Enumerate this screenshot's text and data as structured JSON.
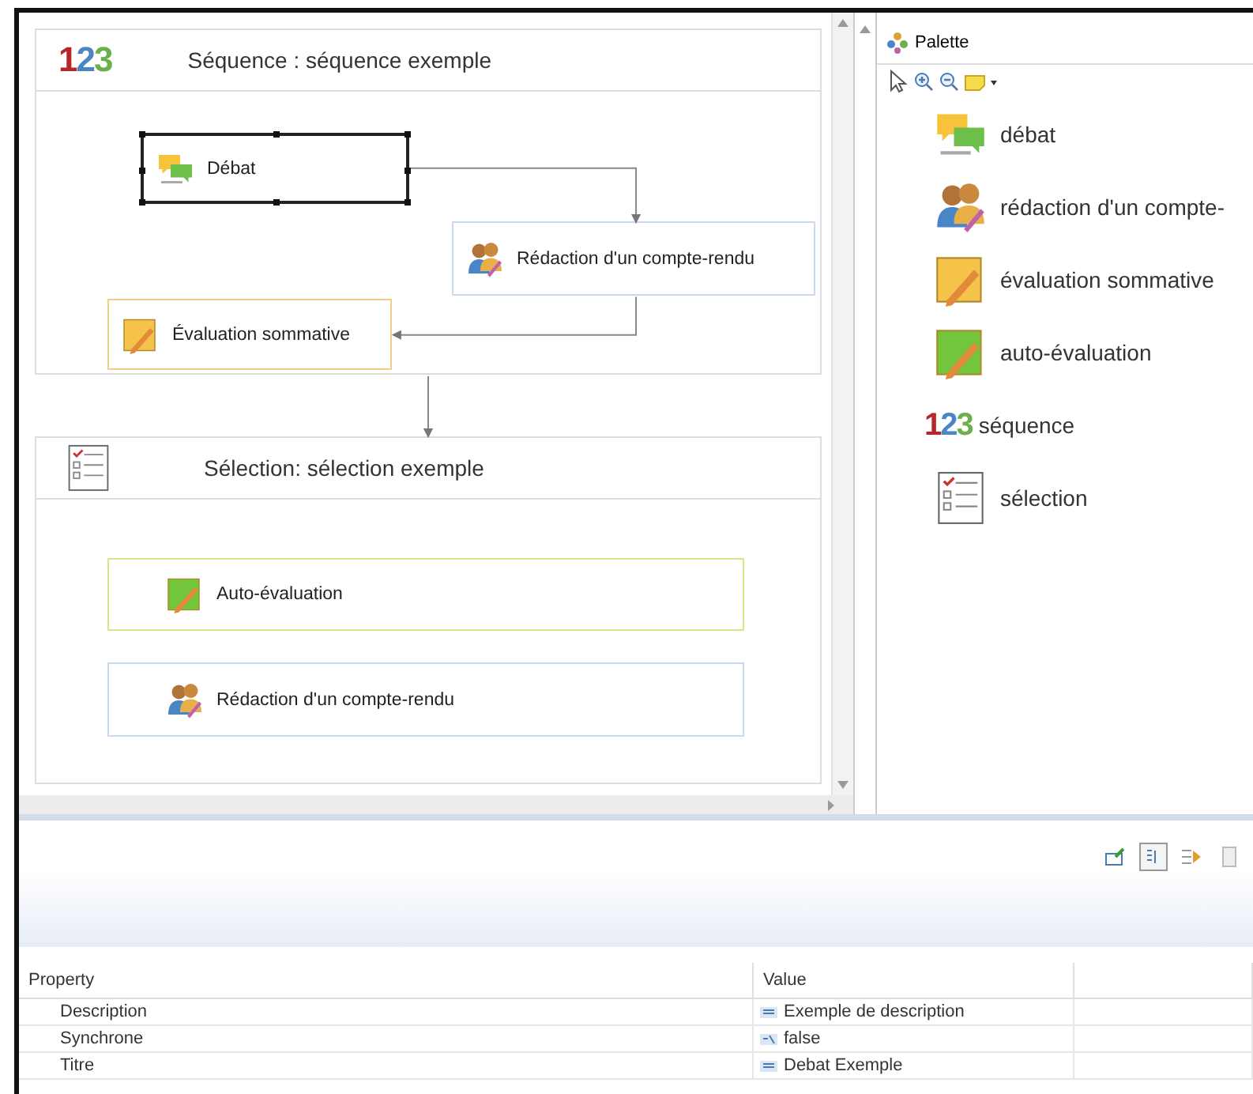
{
  "diagram": {
    "containers": [
      {
        "kind": "sequence",
        "logo": "123",
        "title": "Séquence : séquence exemple",
        "nodes": [
          {
            "kind": "debat",
            "label": "Débat",
            "selected": true
          },
          {
            "kind": "redaction",
            "label": "Rédaction d'un compte-rendu",
            "selected": false
          },
          {
            "kind": "evaluation",
            "label": "Évaluation sommative",
            "selected": false
          }
        ]
      },
      {
        "kind": "selection",
        "title": "Sélection: sélection exemple",
        "nodes": [
          {
            "kind": "auto",
            "label": "Auto-évaluation",
            "selected": false
          },
          {
            "kind": "redaction",
            "label": "Rédaction d'un compte-rendu",
            "selected": false
          }
        ]
      }
    ]
  },
  "palette": {
    "title": "Palette",
    "items": [
      {
        "kind": "debat",
        "label": "débat"
      },
      {
        "kind": "redaction",
        "label": "rédaction d'un compte-"
      },
      {
        "kind": "evaluation",
        "label": "évaluation sommative"
      },
      {
        "kind": "auto",
        "label": "auto-évaluation"
      },
      {
        "kind": "sequence",
        "logo": "123",
        "label": "séquence"
      },
      {
        "kind": "selection",
        "label": "sélection"
      }
    ]
  },
  "properties": {
    "columns": [
      "Property",
      "Value"
    ],
    "rows": [
      {
        "property": "Description",
        "value": "Exemple de description",
        "kind": "text"
      },
      {
        "property": "Synchrone",
        "value": "false",
        "kind": "boolean"
      },
      {
        "property": "Titre",
        "value": "Debat Exemple",
        "kind": "text"
      }
    ]
  }
}
